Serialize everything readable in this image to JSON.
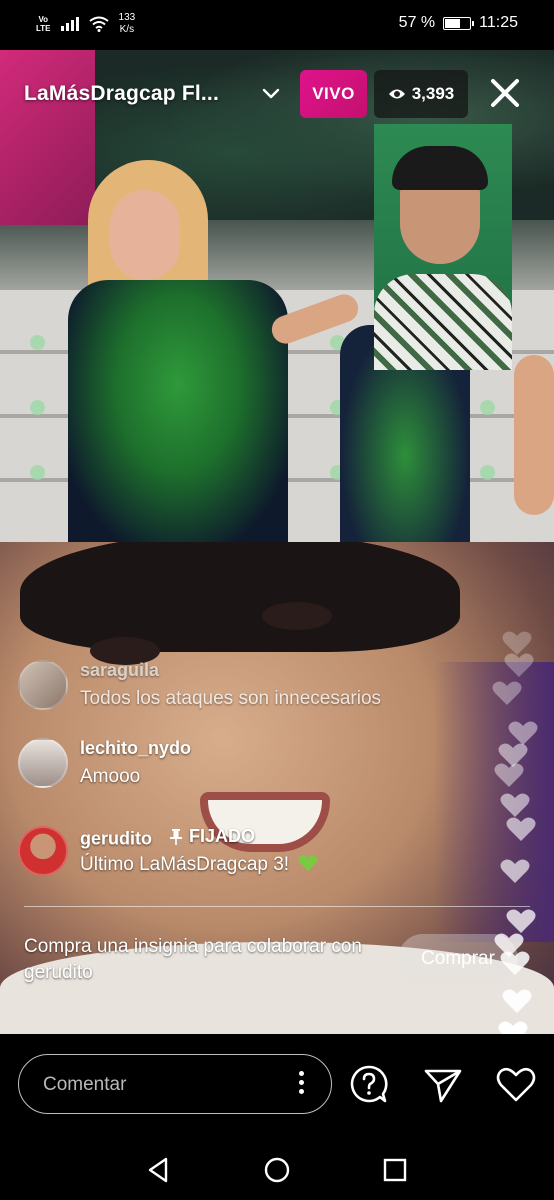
{
  "status_bar": {
    "network_top": "Vo",
    "network_bottom": "LTE",
    "speed_value": "133",
    "speed_unit": "K/s",
    "battery_percent": "57 %",
    "battery_level": 0.57,
    "time": "11:25"
  },
  "header": {
    "stream_title": "LaMásDragcap Fl...",
    "live_label": "VIVO",
    "viewer_count": "3,393"
  },
  "comments": [
    {
      "username": "saraguila",
      "text": "Todos los ataques son innecesarios",
      "pinned": false
    },
    {
      "username": "lechito_nydo",
      "text": "Amooo",
      "pinned": false
    },
    {
      "username": "gerudito",
      "text": "Último LaMásDragcap 3!",
      "pinned": true,
      "pinned_label": "FIJADO",
      "emoji": "green-heart"
    }
  ],
  "badge_promo": {
    "text": "Compra una insignia para colaborar con gerudito",
    "button_label": "Comprar"
  },
  "bottom_bar": {
    "comment_placeholder": "Comentar"
  },
  "colors": {
    "live_badge": "#e0138b",
    "viewer_badge_bg": "#141414",
    "green_heart": "#7ac943"
  },
  "icons": {
    "question": "question-icon",
    "share": "paper-plane-icon",
    "like": "heart-icon"
  }
}
